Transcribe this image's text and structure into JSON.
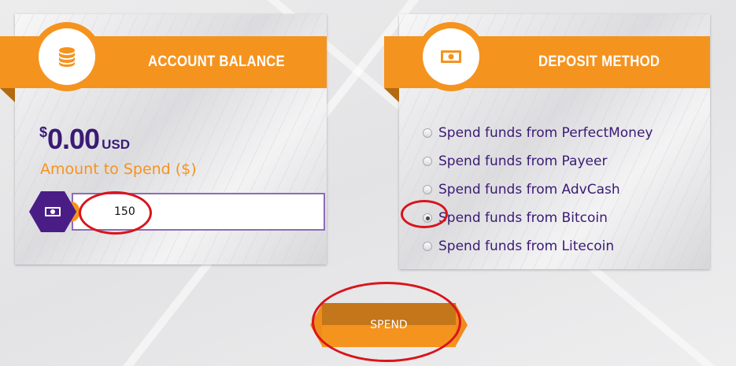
{
  "account_balance": {
    "title": "ACCOUNT BALANCE",
    "icon": "coin-stack-icon",
    "currency_symbol": "$",
    "amount": "0.00",
    "unit": "USD",
    "spend_label": "Amount to Spend ($)",
    "input_icon": "banknote-icon",
    "input_value": "150"
  },
  "deposit_method": {
    "title": "DEPOSIT METHOD",
    "icon": "banknote-icon",
    "options": [
      {
        "label": "Spend funds from PerfectMoney",
        "checked": false
      },
      {
        "label": "Spend funds from Payeer",
        "checked": false
      },
      {
        "label": "Spend funds from AdvCash",
        "checked": false
      },
      {
        "label": "Spend funds from Bitcoin",
        "checked": true
      },
      {
        "label": "Spend funds from Litecoin",
        "checked": false
      }
    ]
  },
  "spend_button": {
    "label": "SPEND"
  },
  "colors": {
    "accent_orange": "#f5931f",
    "deep_purple": "#3b1a74",
    "annotation_red": "#d9141c"
  }
}
